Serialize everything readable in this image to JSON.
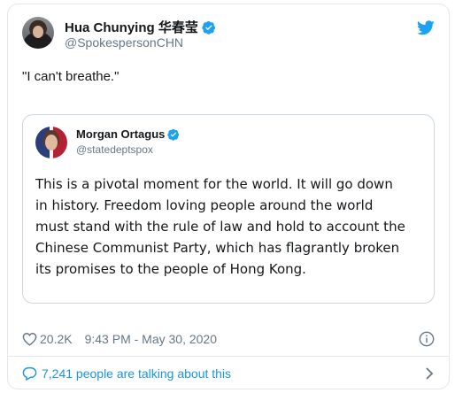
{
  "author": {
    "name": "Hua Chunying 华春莹",
    "handle": "@SpokespersonCHN"
  },
  "tweet": {
    "text": "\"I can't breathe.\""
  },
  "quoted": {
    "name": "Morgan Ortagus",
    "handle": "@statedeptspox",
    "lines": [
      "This is a pivotal moment for the world. It will go down",
      "in history. Freedom loving people around the world",
      "must stand with the rule of law and hold to account the",
      "Chinese Communist Party, which has flagrantly broken",
      "its promises to the people of Hong Kong."
    ]
  },
  "meta": {
    "likes": "20.2K",
    "timestamp": "9:43 PM - May 30, 2020"
  },
  "conversation": {
    "label": "7,241 people are talking about this"
  },
  "icons": {
    "verified": "verified-badge-icon",
    "bird": "twitter-bird-icon",
    "heart": "heart-icon",
    "info": "info-icon",
    "bubble": "speech-bubble-icon",
    "chevron": "chevron-right-icon"
  },
  "colors": {
    "accent": "#1da1f2",
    "link": "#1b95e0",
    "muted": "#657786",
    "text": "#14171a"
  }
}
